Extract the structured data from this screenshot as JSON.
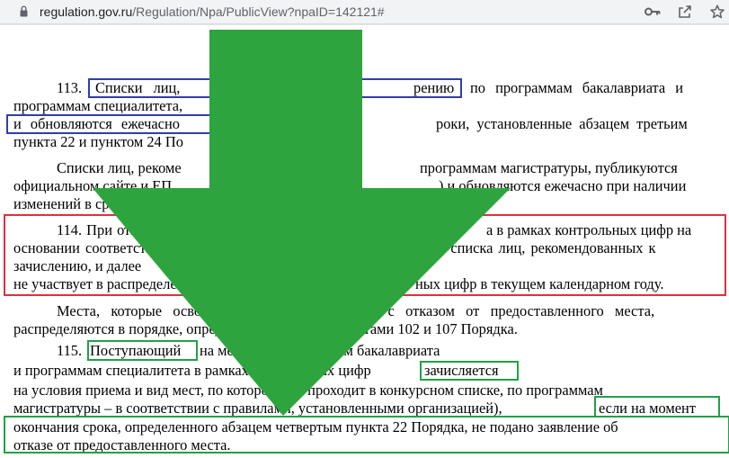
{
  "browser": {
    "url_host": "regulation.gov.ru",
    "url_path": "/Regulation/Npa/PublicView?npaID=142121#",
    "icons": [
      "key-icon",
      "share-icon",
      "star-icon"
    ]
  },
  "document": {
    "p113": {
      "l1_a": "113.",
      "l1_b": "Списки лиц,",
      "l1_c": "рению",
      "l1_d": "по программам бакалавриата и",
      "l2": "программам специалитета,",
      "l3_a": "и обновляются ежечасно",
      "l3_b": "роки, установленные абзацем третьим",
      "l4": "пункта 22 и пунктом 24 По"
    },
    "p113b": {
      "l1_a": "Списки лиц, рекоме",
      "l1_b": "программам магистратуры, публикуются",
      "l2_a": "официальном сайте и ЕП",
      "l2_b": ") и обновляются ежечасно при наличии",
      "l3": "изменений в ср"
    },
    "p114": {
      "l1_a": "114. При отказ",
      "l1_b": "а в рамках контрольных цифр на",
      "l2_a": "основании соответству",
      "l2_b": "из списка лиц, рекомендованных к",
      "l3": "зачислению, и далее",
      "l4_a": "не участвует в распределени",
      "l4_b": "ных цифр в текущем календарном году."
    },
    "p114b": {
      "l1_a": "Места,   которые   освободил",
      "l1_b": "зи   с   отказом   от   предоставленного   места,",
      "l2_a": "распределяются в порядке, определен",
      "l2_b": "нктами 102 и 107 Порядка."
    },
    "p115": {
      "l1_a": "115.",
      "l1_b": "Поступающий",
      "l1_c": "на места по программам бакалавриата",
      "l2_a": "и программам специалитета в рамках контрольных цифр",
      "l2_b": "зачисляется",
      "l3": "на условия приема и вид мест, по которому он проходит в конкурсном списке, по программам",
      "l4_a": "магистратуры – в соответствии с правилами, установленными организацией),",
      "l4_b": "если на момент",
      "l5": "окончания срока, определенного абзацем четвертым пункта 22 Порядка, не подано заявление об",
      "l6": "отказе от предоставленного места."
    }
  },
  "colors": {
    "arrow": "#2ea43f",
    "box_blue": "#2e3fa8",
    "box_red": "#d9333f",
    "box_green": "#21a146"
  }
}
